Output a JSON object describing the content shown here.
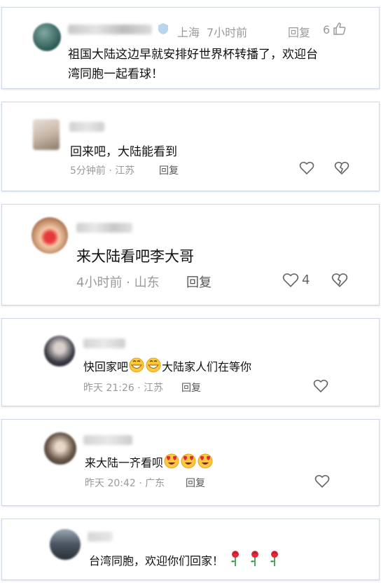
{
  "comments": [
    {
      "location": "上海",
      "time": "7小时前",
      "reply_label": "回复",
      "like_count": "6",
      "content": [
        "祖国大陆这边早就安排好世界杯转播了，欢迎台",
        "湾同胞一起看球！"
      ]
    },
    {
      "content": "回来吧，大陆能看到",
      "meta": "5分钟前 · 江苏",
      "reply_label": "回复"
    },
    {
      "content": "来大陆看吧李大哥",
      "meta": "4小时前 · 山东",
      "reply_label": "回复",
      "like_count": "4"
    },
    {
      "content_before": "快回家吧",
      "content_after": "大陆家人们在等你",
      "emojis": [
        "grin-emoji",
        "grin-emoji"
      ],
      "meta": "昨天 21:26 · 江苏",
      "reply_label": "回复"
    },
    {
      "content": "来大陆一齐看呗",
      "emojis": [
        "heart-eyes-emoji",
        "heart-eyes-emoji",
        "heart-eyes-emoji"
      ],
      "meta": "昨天 20:42 · 广东",
      "reply_label": "回复"
    },
    {
      "content": "台湾同胞，欢迎你们回家！",
      "emojis": [
        "rose-emoji",
        "rose-emoji",
        "rose-emoji"
      ]
    }
  ],
  "colors": {
    "card_border": "#cfd6e6",
    "meta_gray": "#9a9a9a",
    "text": "#111111"
  }
}
